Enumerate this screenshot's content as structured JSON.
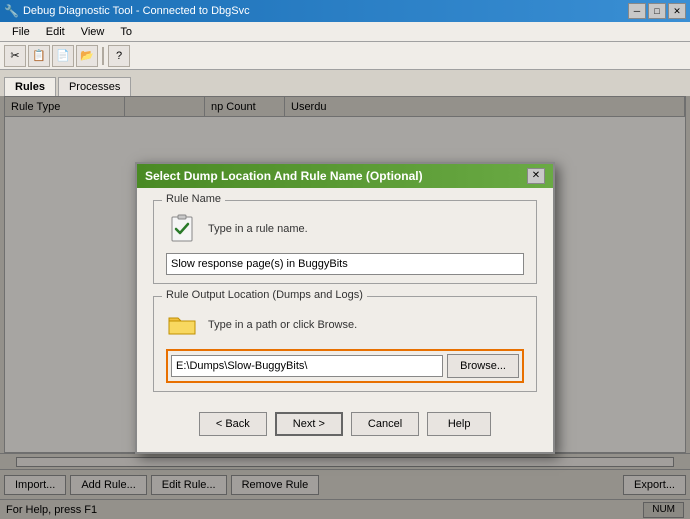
{
  "app": {
    "title": "Debug Diagnostic Tool - Connected to DbgSvc",
    "icon": "🔧"
  },
  "menu": {
    "items": [
      "File",
      "Edit",
      "View",
      "To"
    ]
  },
  "tabs": {
    "items": [
      {
        "label": "Rules",
        "active": true
      },
      {
        "label": "Processes",
        "active": false
      }
    ]
  },
  "table": {
    "columns": [
      "Rule Type",
      "",
      "np Count",
      "Userdu"
    ]
  },
  "bottom_toolbar": {
    "buttons": [
      "Import...",
      "Add Rule...",
      "Edit Rule...",
      "Remove Rule",
      "Export..."
    ]
  },
  "status_bar": {
    "text": "For Help, press F1",
    "num_label": "NUM"
  },
  "modal": {
    "title": "Select Dump Location And Rule Name (Optional)",
    "close_btn": "✕",
    "rule_name_group": "Rule Name",
    "rule_name_hint": "Type in a rule name.",
    "rule_name_value": "Slow response page(s) in BuggyBits",
    "output_group": "Rule Output Location (Dumps and Logs)",
    "output_hint": "Type in a path or click Browse.",
    "output_value": "E:\\Dumps\\Slow-BuggyBits\\",
    "browse_btn": "Browse...",
    "buttons": {
      "back": "< Back",
      "next": "Next >",
      "cancel": "Cancel",
      "help": "Help"
    }
  },
  "toolbar": {
    "buttons": [
      "✂",
      "📋",
      "📄",
      "📂",
      "?"
    ]
  }
}
